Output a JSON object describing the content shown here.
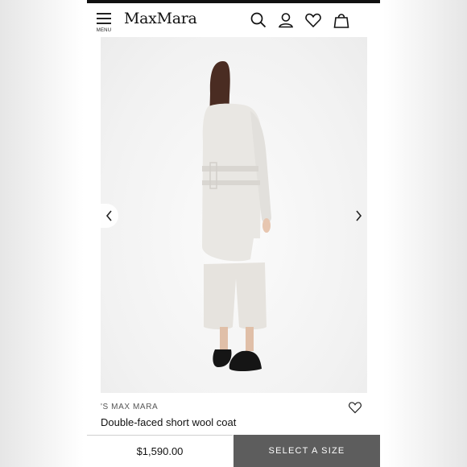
{
  "header": {
    "menu_label": "MENU",
    "logo": "MaxMara",
    "icons": [
      "search-icon",
      "account-icon",
      "wishlist-heart-icon",
      "shopping-bag-icon"
    ]
  },
  "gallery": {
    "image_alt": "Model wearing a light ivory belted wool coat over wide cropped trousers and black loafers, seen from behind",
    "prev_icon": "chevron-left-icon",
    "next_icon": "chevron-right-icon"
  },
  "product": {
    "brand": "'S MAX MARA",
    "name": "Double-faced short wool coat",
    "wishlist_icon": "heart-outline-icon"
  },
  "purchase": {
    "price": "$1,590.00",
    "cta": "SELECT A SIZE"
  },
  "colors": {
    "cta_background": "#5d5d5d",
    "text": "#111111"
  }
}
